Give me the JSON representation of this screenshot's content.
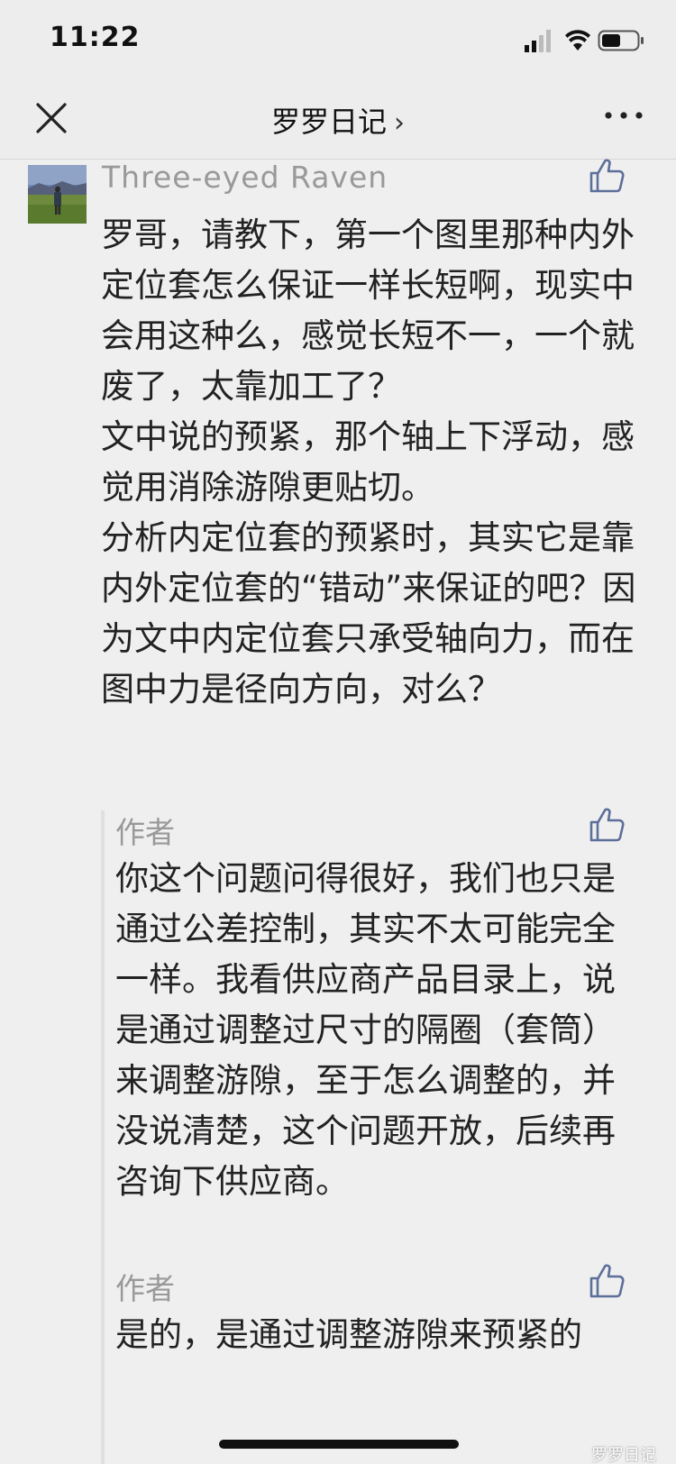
{
  "status_bar": {
    "time": "11:22",
    "icons": [
      "signal-icon",
      "wifi-icon",
      "battery-icon"
    ]
  },
  "nav": {
    "title": "罗罗日记",
    "chevron": "›",
    "close_icon": "close-icon",
    "more_icon": "more-icon"
  },
  "comment": {
    "author": "Three-eyed Raven",
    "text": "罗哥，请教下，第一个图里那种内外定位套怎么保证一样长短啊，现实中会用这种么，感觉长短不一，一个就废了，太靠加工了？\n文中说的预紧，那个轴上下浮动，感觉用消除游隙更贴切。\n分析内定位套的预紧时，其实它是靠内外定位套的“错动”来保证的吧？因为文中内定位套只承受轴向力，而在图中力是径向方向，对么？"
  },
  "replies": [
    {
      "author": "作者",
      "text": "你这个问题问得很好，我们也只是通过公差控制，其实不太可能完全一样。我看供应商产品目录上，说是通过调整过尺寸的隔圈（套筒）来调整游隙，至于怎么调整的，并没说清楚，这个问题开放，后续再咨询下供应商。"
    },
    {
      "author": "作者",
      "text": "是的，是通过调整游隙来预紧的"
    }
  ],
  "watermark": "罗罗日记",
  "colors": {
    "background": "#efefef",
    "nav_background": "#ededed",
    "meta_text": "#999999",
    "body_text": "#222222",
    "like_icon": "#5c6f9a"
  }
}
